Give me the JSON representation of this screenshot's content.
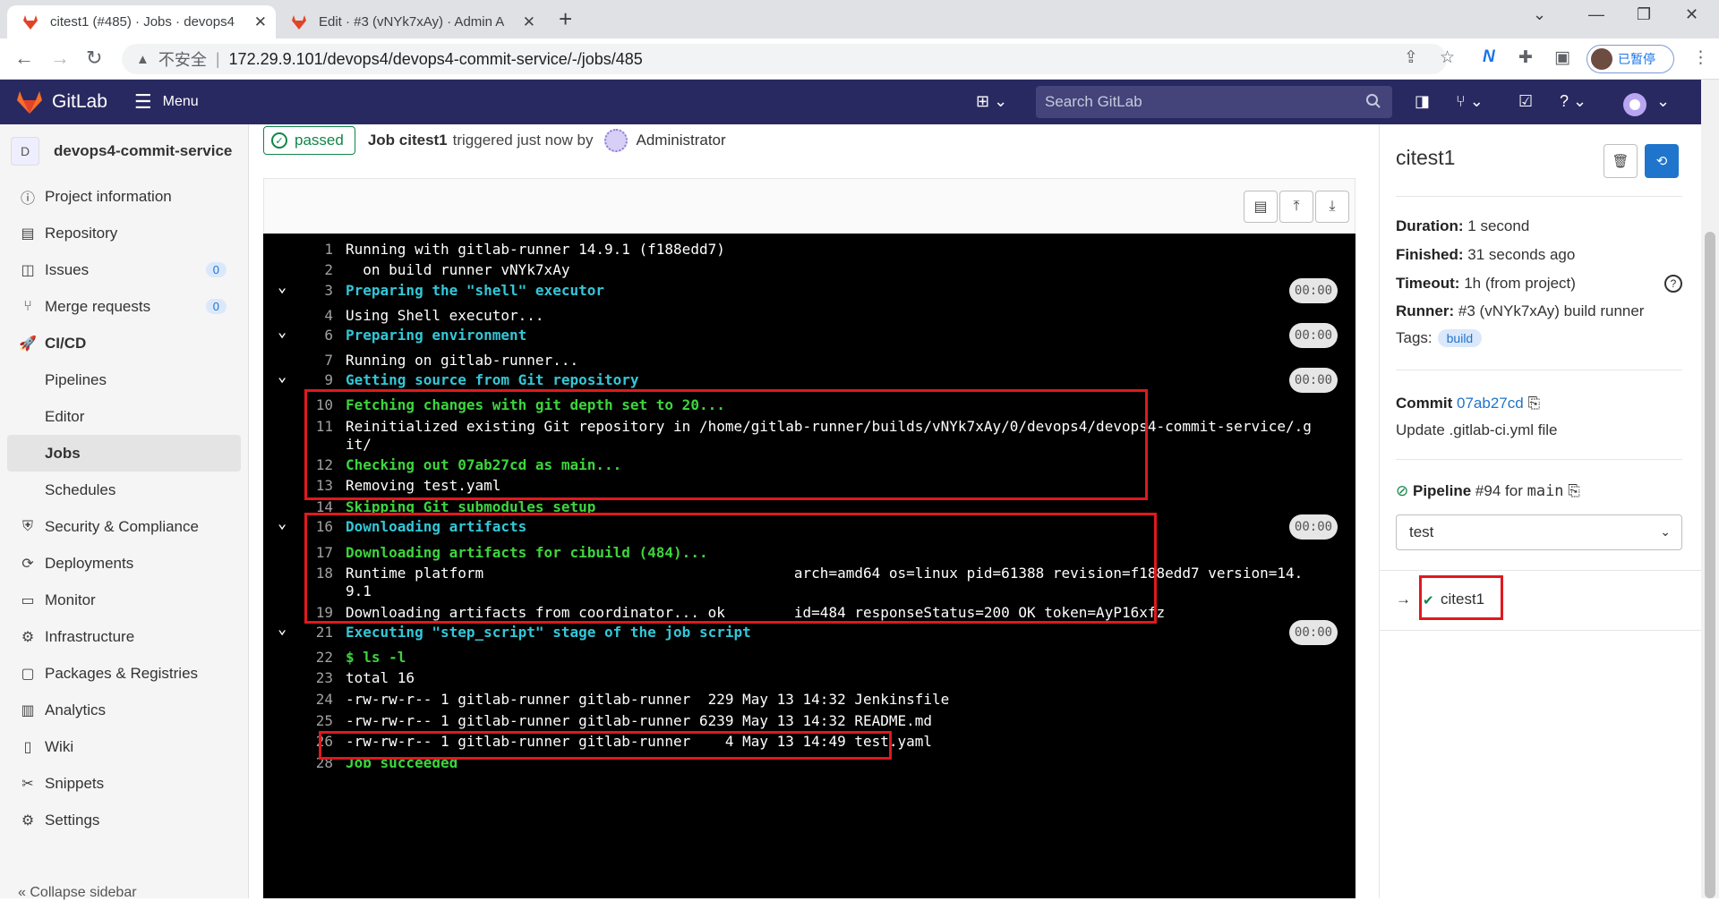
{
  "browser": {
    "tabs": [
      {
        "title": "citest1 (#485) · Jobs · devops4",
        "active": true
      },
      {
        "title": "Edit · #3 (vNYk7xAy) · Admin A",
        "active": false
      }
    ],
    "address": {
      "security": "不安全",
      "url": "172.29.9.101/devops4/devops4-commit-service/-/jobs/485"
    },
    "profile_status": "已暂停"
  },
  "gitlab": {
    "brand": "GitLab",
    "menu_label": "Menu",
    "search_placeholder": "Search GitLab"
  },
  "sidebar": {
    "project_avatar": "D",
    "project_name": "devops4-commit-service",
    "items": [
      {
        "label": "Project information",
        "icon": "info-icon"
      },
      {
        "label": "Repository",
        "icon": "doc-icon"
      },
      {
        "label": "Issues",
        "icon": "issues-icon",
        "badge": "0"
      },
      {
        "label": "Merge requests",
        "icon": "merge-icon",
        "badge": "0"
      },
      {
        "label": "CI/CD",
        "icon": "rocket-icon"
      },
      {
        "label": "Pipelines",
        "sub": true
      },
      {
        "label": "Editor",
        "sub": true
      },
      {
        "label": "Jobs",
        "sub": true,
        "active": true
      },
      {
        "label": "Schedules",
        "sub": true
      },
      {
        "label": "Security & Compliance",
        "icon": "shield-icon"
      },
      {
        "label": "Deployments",
        "icon": "deploy-icon"
      },
      {
        "label": "Monitor",
        "icon": "monitor-icon"
      },
      {
        "label": "Infrastructure",
        "icon": "infra-icon"
      },
      {
        "label": "Packages & Registries",
        "icon": "package-icon"
      },
      {
        "label": "Analytics",
        "icon": "chart-icon"
      },
      {
        "label": "Wiki",
        "icon": "book-icon"
      },
      {
        "label": "Snippets",
        "icon": "scissors-icon"
      },
      {
        "label": "Settings",
        "icon": "gear-icon"
      }
    ],
    "collapse_label": "Collapse sidebar"
  },
  "job": {
    "status": "passed",
    "title": "Job citest1",
    "triggered": "triggered just now by",
    "user": "Administrator"
  },
  "log": [
    {
      "n": "1",
      "text": "Running with gitlab-runner 14.9.1 (f188edd7)",
      "style": "plain"
    },
    {
      "n": "2",
      "text": "  on build runner vNYk7xAy",
      "style": "plain"
    },
    {
      "n": "3",
      "text": "Preparing the \"shell\" executor",
      "style": "cyan",
      "section": true,
      "dur": "00:00"
    },
    {
      "n": "4",
      "text": "Using Shell executor...",
      "style": "plain"
    },
    {
      "n": "6",
      "text": "Preparing environment",
      "style": "cyan",
      "section": true,
      "dur": "00:00"
    },
    {
      "n": "7",
      "text": "Running on gitlab-runner...",
      "style": "plain"
    },
    {
      "n": "9",
      "text": "Getting source from Git repository",
      "style": "cyan",
      "section": true,
      "dur": "00:00"
    },
    {
      "n": "10",
      "text": "Fetching changes with git depth set to 20...",
      "style": "green"
    },
    {
      "n": "11",
      "text": "Reinitialized existing Git repository in /home/gitlab-runner/builds/vNYk7xAy/0/devops4/devops4-commit-service/.g",
      "style": "plain"
    },
    {
      "n": "",
      "text": "it/",
      "style": "plain"
    },
    {
      "n": "12",
      "text": "Checking out 07ab27cd as main...",
      "style": "green"
    },
    {
      "n": "13",
      "text": "Removing test.yaml",
      "style": "plain"
    },
    {
      "n": "14",
      "text": "Skipping Git submodules setup",
      "style": "green"
    },
    {
      "n": "16",
      "text": "Downloading artifacts",
      "style": "cyan",
      "section": true,
      "dur": "00:00"
    },
    {
      "n": "17",
      "text": "Downloading artifacts for cibuild (484)...",
      "style": "green"
    },
    {
      "n": "18",
      "text": "Runtime platform                                    arch=amd64 os=linux pid=61388 revision=f188edd7 version=14.",
      "style": "plain"
    },
    {
      "n": "",
      "text": "9.1",
      "style": "plain"
    },
    {
      "n": "19",
      "text": "Downloading artifacts from coordinator... ok        id=484 responseStatus=200 OK token=AyP16xfz",
      "style": "plain"
    },
    {
      "n": "21",
      "text": "Executing \"step_script\" stage of the job script",
      "style": "cyan",
      "section": true,
      "dur": "00:00"
    },
    {
      "n": "22",
      "text": "$ ls -l",
      "style": "green"
    },
    {
      "n": "23",
      "text": "total 16",
      "style": "plain"
    },
    {
      "n": "24",
      "text": "-rw-rw-r-- 1 gitlab-runner gitlab-runner  229 May 13 14:32 Jenkinsfile",
      "style": "plain"
    },
    {
      "n": "25",
      "text": "-rw-rw-r-- 1 gitlab-runner gitlab-runner 6239 May 13 14:32 README.md",
      "style": "plain"
    },
    {
      "n": "26",
      "text": "-rw-rw-r-- 1 gitlab-runner gitlab-runner    4 May 13 14:49 test.yaml",
      "style": "plain"
    },
    {
      "n": "28",
      "text": "Job succeeded",
      "style": "green"
    }
  ],
  "panel": {
    "title": "citest1",
    "duration_label": "Duration:",
    "duration": "1 second",
    "finished_label": "Finished:",
    "finished": "31 seconds ago",
    "timeout_label": "Timeout:",
    "timeout": "1h (from project)",
    "runner_label": "Runner:",
    "runner": "#3 (vNYk7xAy) build runner",
    "tags_label": "Tags:",
    "tag": "build",
    "commit_label": "Commit",
    "commit_sha": "07ab27cd",
    "commit_message": "Update .gitlab-ci.yml file",
    "pipeline_label": "Pipeline",
    "pipeline_id": "#94",
    "pipeline_for": "for",
    "pipeline_ref": "main",
    "stage": "test",
    "job_entry": "citest1"
  },
  "colors": {
    "navbar": "#292961",
    "success": "#108548",
    "link": "#1f75cb",
    "highlight": "#e0191d"
  }
}
